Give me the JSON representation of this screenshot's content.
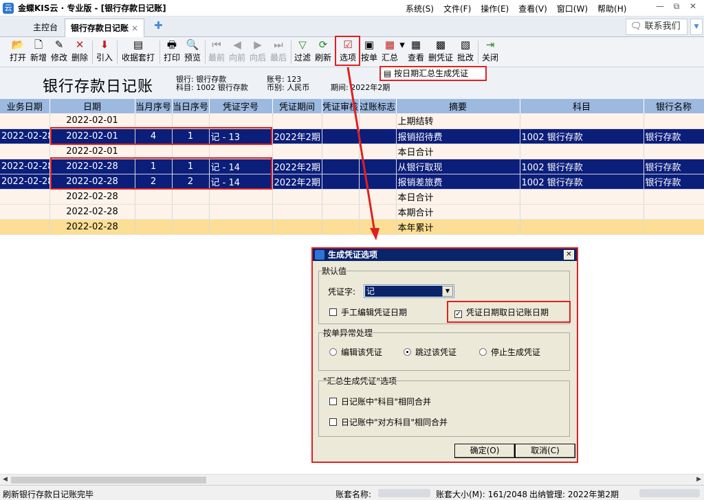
{
  "app": {
    "logo_char": "云",
    "title": "金蝶KIS云 · 专业版 - [银行存款日记账]"
  },
  "menu": [
    "系统(S)",
    "文件(F)",
    "操作(E)",
    "查看(V)",
    "窗口(W)",
    "帮助(H)"
  ],
  "window_controls": {
    "minimize": "—",
    "restore": "⧉",
    "close": "✕"
  },
  "tabs": {
    "home": "主控台",
    "active": "银行存款日记账",
    "close": "×",
    "add": "✚"
  },
  "contact": {
    "label": "🗨 联系我们",
    "chevron": "▼"
  },
  "toolbar": [
    {
      "name": "open",
      "label": "打开",
      "icon": "📂",
      "disabled": false
    },
    {
      "name": "new",
      "label": "新增",
      "icon": "🗋",
      "disabled": false
    },
    {
      "name": "edit",
      "label": "修改",
      "icon": "✎",
      "disabled": false
    },
    {
      "name": "delete",
      "label": "删除",
      "icon": "✕",
      "disabled": false
    },
    {
      "name": "import",
      "label": "引入",
      "icon": "⬇",
      "disabled": false
    },
    {
      "name": "receipt-template",
      "label": "收据套打",
      "icon": "▤",
      "disabled": false
    },
    {
      "name": "print",
      "label": "打印",
      "icon": "🖶",
      "disabled": false
    },
    {
      "name": "preview",
      "label": "预览",
      "icon": "🔍",
      "disabled": false
    },
    {
      "name": "first",
      "label": "最前",
      "icon": "⏮",
      "disabled": true
    },
    {
      "name": "prev",
      "label": "向前",
      "icon": "◀",
      "disabled": true
    },
    {
      "name": "next",
      "label": "向后",
      "icon": "▶",
      "disabled": true
    },
    {
      "name": "last",
      "label": "最后",
      "icon": "⏭",
      "disabled": true
    },
    {
      "name": "filter",
      "label": "过滤",
      "icon": "▽",
      "disabled": false
    },
    {
      "name": "refresh",
      "label": "刷新",
      "icon": "⟳",
      "disabled": false
    },
    {
      "name": "options",
      "label": "选项",
      "icon": "☑",
      "disabled": false
    },
    {
      "name": "by-voucher",
      "label": "按单",
      "icon": "▣",
      "disabled": false
    },
    {
      "name": "summary",
      "label": "汇总",
      "icon": "▦",
      "disabled": false
    },
    {
      "name": "view",
      "label": "查看",
      "icon": "▦",
      "disabled": false
    },
    {
      "name": "delete-voucher",
      "label": "删凭证",
      "icon": "▩",
      "disabled": false
    },
    {
      "name": "batch-edit",
      "label": "批改",
      "icon": "▧",
      "disabled": false
    },
    {
      "name": "close",
      "label": "关闭",
      "icon": "⇥",
      "disabled": false
    }
  ],
  "submenu": {
    "icon": "▤",
    "label": "按日期汇总生成凭证"
  },
  "report": {
    "title": "银行存款日记账",
    "bank_label": "银行: 银行存款",
    "subject_label": "科目: 1002 银行存款",
    "account_no": "账号: 123",
    "currency": "币别: 人民币",
    "period": "期间: 2022年2期"
  },
  "table": {
    "headers": [
      "业务日期",
      "日期",
      "当月序号",
      "当日序号",
      "凭证字号",
      "凭证期间",
      "凭证审核",
      "过账标志",
      "摘要",
      "科目",
      "银行名称"
    ],
    "rows": [
      {
        "type": "pale",
        "cells": [
          "",
          "2022-02-01",
          "",
          "",
          "",
          "",
          "",
          "",
          "上期结转",
          "",
          ""
        ]
      },
      {
        "type": "sel",
        "cells": [
          "2022-02-28",
          "2022-02-01",
          "4",
          "1",
          "记 - 13",
          "2022年2期",
          "",
          "",
          "报销招待费",
          "1002 银行存款",
          "银行存款"
        ]
      },
      {
        "type": "pale",
        "cells": [
          "",
          "2022-02-01",
          "",
          "",
          "",
          "",
          "",
          "",
          "本日合计",
          "",
          ""
        ]
      },
      {
        "type": "sel",
        "cells": [
          "2022-02-28",
          "2022-02-28",
          "1",
          "1",
          "记 - 14",
          "2022年2期",
          "",
          "",
          "从银行取现",
          "1002 银行存款",
          "银行存款"
        ]
      },
      {
        "type": "sel",
        "cells": [
          "2022-02-28",
          "2022-02-28",
          "2",
          "2",
          "记 - 14",
          "2022年2期",
          "",
          "",
          "报销差旅费",
          "1002 银行存款",
          "银行存款"
        ]
      },
      {
        "type": "pale",
        "cells": [
          "",
          "2022-02-28",
          "",
          "",
          "",
          "",
          "",
          "",
          "本日合计",
          "",
          ""
        ]
      },
      {
        "type": "pale",
        "cells": [
          "",
          "2022-02-28",
          "",
          "",
          "",
          "",
          "",
          "",
          "本期合计",
          "",
          ""
        ]
      },
      {
        "type": "year",
        "cells": [
          "",
          "2022-02-28",
          "",
          "",
          "",
          "",
          "",
          "",
          "本年累计",
          "",
          ""
        ]
      }
    ]
  },
  "dialog": {
    "title": "生成凭证选项",
    "close": "✕",
    "defaults_group": "默认值",
    "voucher_word_label": "凭证字:",
    "voucher_word_value": "记",
    "manual_edit_date": {
      "label": "手工编辑凭证日期",
      "checked": false
    },
    "use_journal_date": {
      "label": "凭证日期取日记账日期",
      "checked": true
    },
    "exception_group": "按单异常处理",
    "radios": [
      {
        "label": "编辑该凭证",
        "selected": false
      },
      {
        "label": "跳过该凭证",
        "selected": true
      },
      {
        "label": "停止生成凭证",
        "selected": false
      }
    ],
    "summary_group": "\"汇总生成凭证\"选项",
    "merge_subject": {
      "label": "日记账中\"科目\"相同合并",
      "checked": false
    },
    "merge_contra": {
      "label": "日记账中\"对方科目\"相同合并",
      "checked": false
    },
    "ok": "确定(O)",
    "cancel": "取消(C)"
  },
  "status": {
    "message": "刷新银行存款日记账完毕",
    "account_set_label": "账套名称:",
    "account_size": "账套大小(M): 161/2048",
    "cashier": "出纳管理: 2022年第2期"
  },
  "scroll": {
    "left": "◀",
    "right": "▶"
  },
  "colors": {
    "selected_row": "#0b1e7a",
    "header": "#9cb9e0",
    "highlight": "#e02020",
    "year_row": "#fcdf94"
  }
}
